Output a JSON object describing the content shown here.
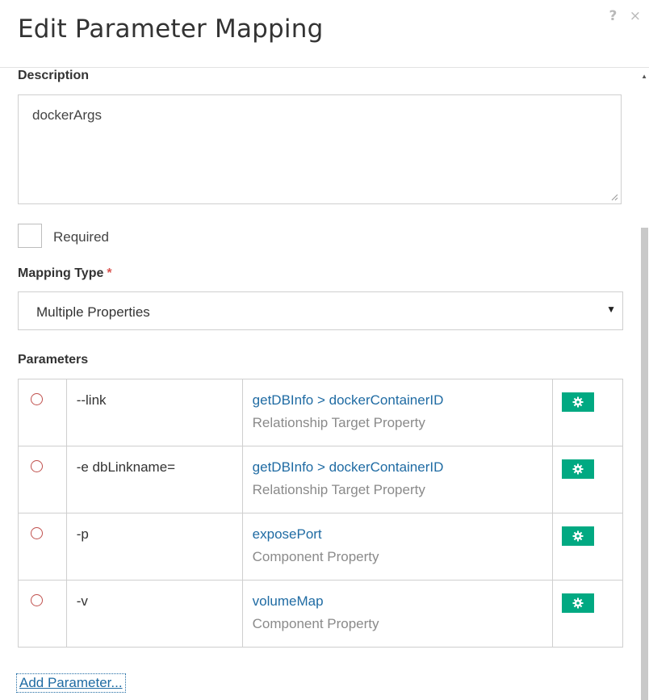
{
  "dialog": {
    "title": "Edit Parameter Mapping",
    "help_icon": "?",
    "close_icon": "×"
  },
  "description": {
    "label": "Description",
    "value": "dockerArgs"
  },
  "required": {
    "label": "Required",
    "checked": false
  },
  "mapping_type": {
    "label": "Mapping Type",
    "required_mark": "*",
    "value": "Multiple Properties",
    "arrow": "▼"
  },
  "parameters": {
    "label": "Parameters",
    "rows": [
      {
        "name": "--link",
        "target": "getDBInfo > dockerContainerID",
        "type": "Relationship Target Property"
      },
      {
        "name": "-e dbLinkname=",
        "target": "getDBInfo > dockerContainerID",
        "type": "Relationship Target Property"
      },
      {
        "name": "-p",
        "target": "exposePort",
        "type": "Component Property"
      },
      {
        "name": "-v",
        "target": "volumeMap",
        "type": "Component Property"
      }
    ]
  },
  "add_parameter_label": "Add Parameter...",
  "colors": {
    "accent": "#01a982",
    "link": "#1f6ba3",
    "required": "#d9534f"
  }
}
